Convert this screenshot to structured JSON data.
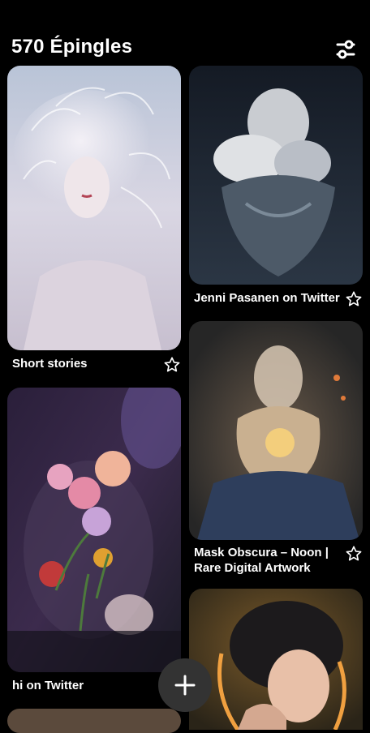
{
  "header": {
    "pin_count_label": "570 Épingles",
    "filter_icon": "sliders-icon"
  },
  "pins": [
    {
      "caption": "Short stories",
      "icon": "star-outline-icon"
    },
    {
      "caption": "Jenni Pasanen on Twitter",
      "icon": "star-outline-icon"
    },
    {
      "caption": "hi on Twitter",
      "icon": "star-outline-icon"
    },
    {
      "caption": "Mask Obscura – Noon | Rare Digital Artwork",
      "icon": "star-outline-icon"
    }
  ],
  "fab": {
    "icon": "plus-icon"
  },
  "colors": {
    "background": "#000000",
    "fab": "#333333",
    "text": "#ffffff"
  }
}
